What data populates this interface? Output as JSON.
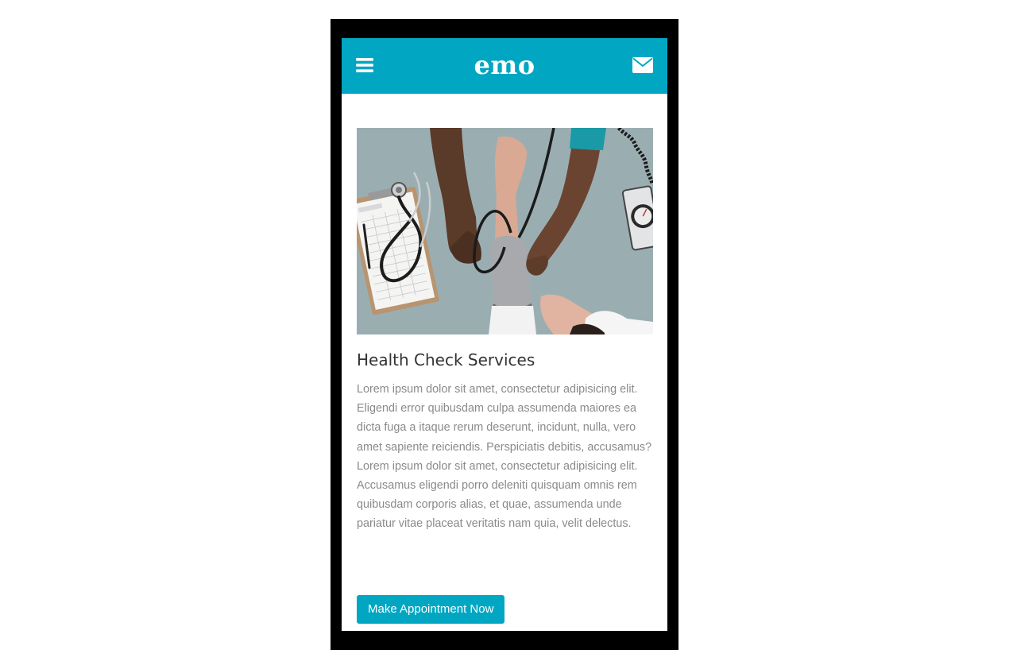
{
  "header": {
    "logo_text": "emo",
    "menu_icon": "hamburger-menu-icon",
    "mail_icon": "envelope-icon",
    "bar_color": "#00a6c2"
  },
  "article": {
    "image_subject": "blood-pressure-check-photo",
    "title": "Health Check Services",
    "body": "Lorem ipsum dolor sit amet, consectetur adipisicing elit. Eligendi error quibusdam culpa assumenda maiores ea dicta fuga a itaque rerum deserunt, incidunt, nulla, vero amet sapiente reiciendis. Perspiciatis debitis, accusamus? Lorem ipsum dolor sit amet, consectetur adipisicing elit. Accusamus eligendi porro deleniti quisquam omnis rem quibusdam corporis alias, et quae, assumenda unde pariatur vitae placeat veritatis nam quia, velit delectus.",
    "cta_label": "Make Appointment Now",
    "accent_color": "#00a6c2"
  }
}
